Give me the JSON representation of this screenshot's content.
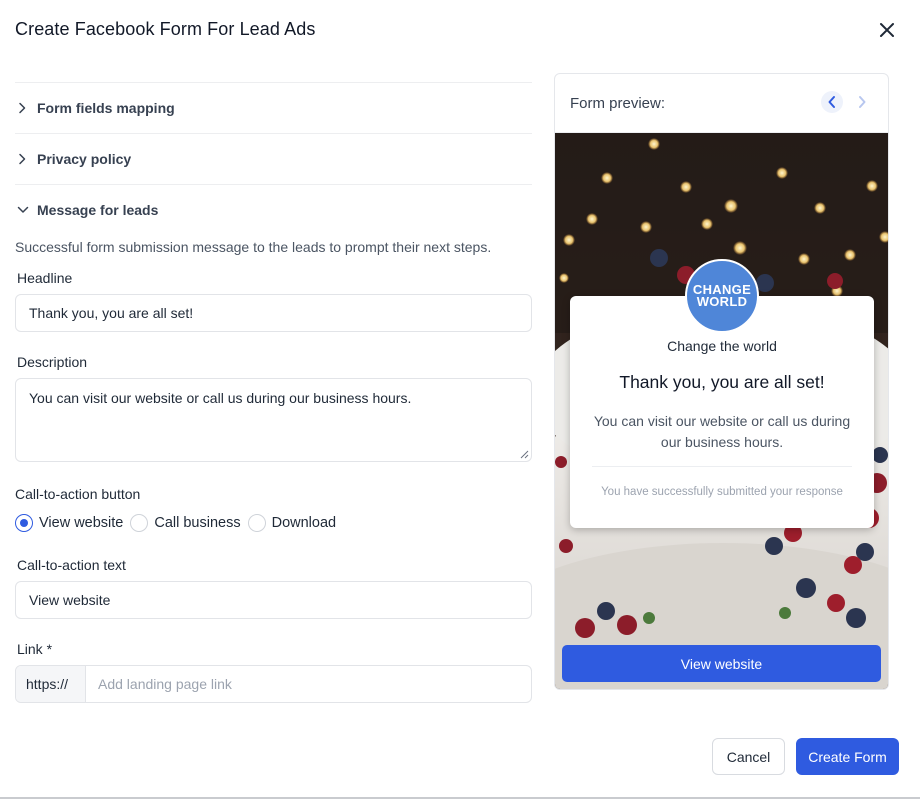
{
  "modal": {
    "title": "Create Facebook Form For Lead Ads"
  },
  "sections": {
    "form_fields": "Form fields mapping",
    "privacy": "Privacy policy",
    "message": "Message for leads"
  },
  "message": {
    "helper": "Successful form submission message to the leads to prompt their next steps.",
    "headline_label": "Headline",
    "headline_value": "Thank you, you are all set!",
    "description_label": "Description",
    "description_value": "You can visit our website or call us during our business hours.",
    "cta_label": "Call-to-action button",
    "cta_options": [
      "View website",
      "Call business",
      "Download"
    ],
    "cta_selected": "View website",
    "cta_text_label": "Call-to-action text",
    "cta_text_value": "View website",
    "link_label": "Link *",
    "link_prefix": "https://",
    "link_placeholder": "Add landing page link"
  },
  "preview": {
    "title": "Form preview:",
    "logo_line1": "CHANGE",
    "logo_line2": "WORLD",
    "business_name": "Change the world",
    "headline": "Thank you, you are all set!",
    "description": "You can visit our website or call us during our business hours.",
    "footer": "You have successfully submitted your response",
    "cta": "View website"
  },
  "footer": {
    "cancel": "Cancel",
    "create": "Create Form"
  },
  "colors": {
    "accent": "#2f5be0",
    "logo_bg": "#4f86d8"
  },
  "icons": {
    "close": "close-icon",
    "chevron_right": "chevron-right-icon",
    "chevron_down": "chevron-down-icon",
    "prev": "chevron-left-icon",
    "next": "chevron-right-icon"
  }
}
